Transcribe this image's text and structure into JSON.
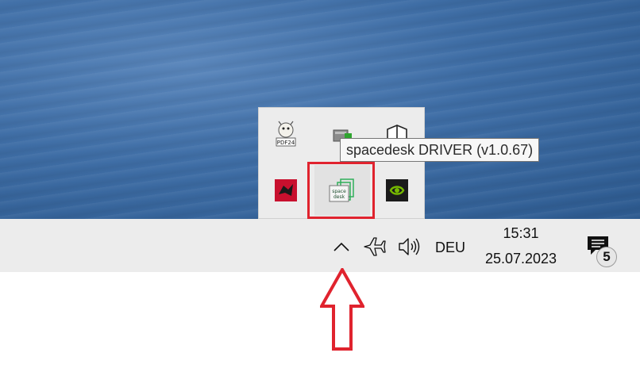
{
  "tray": {
    "tooltip": "spacedesk DRIVER (v1.0.67)",
    "icons": [
      {
        "name": "pdf24-icon",
        "label": "PDF24"
      },
      {
        "name": "network-device-icon"
      },
      {
        "name": "shield-icon"
      },
      {
        "name": "app-red-icon"
      },
      {
        "name": "spacedesk-icon",
        "label": "space desk"
      },
      {
        "name": "nvidia-icon"
      }
    ],
    "highlight_color": "#e0232e"
  },
  "taskbar": {
    "overflow_chevron": "^",
    "airplane_icon": "airplane-icon",
    "volume_icon": "volume-icon",
    "language": "DEU",
    "time": "15:31",
    "date": "25.07.2023",
    "notification_count": "5"
  },
  "annotation": {
    "arrow_color": "#e0232e",
    "direction": "up"
  }
}
